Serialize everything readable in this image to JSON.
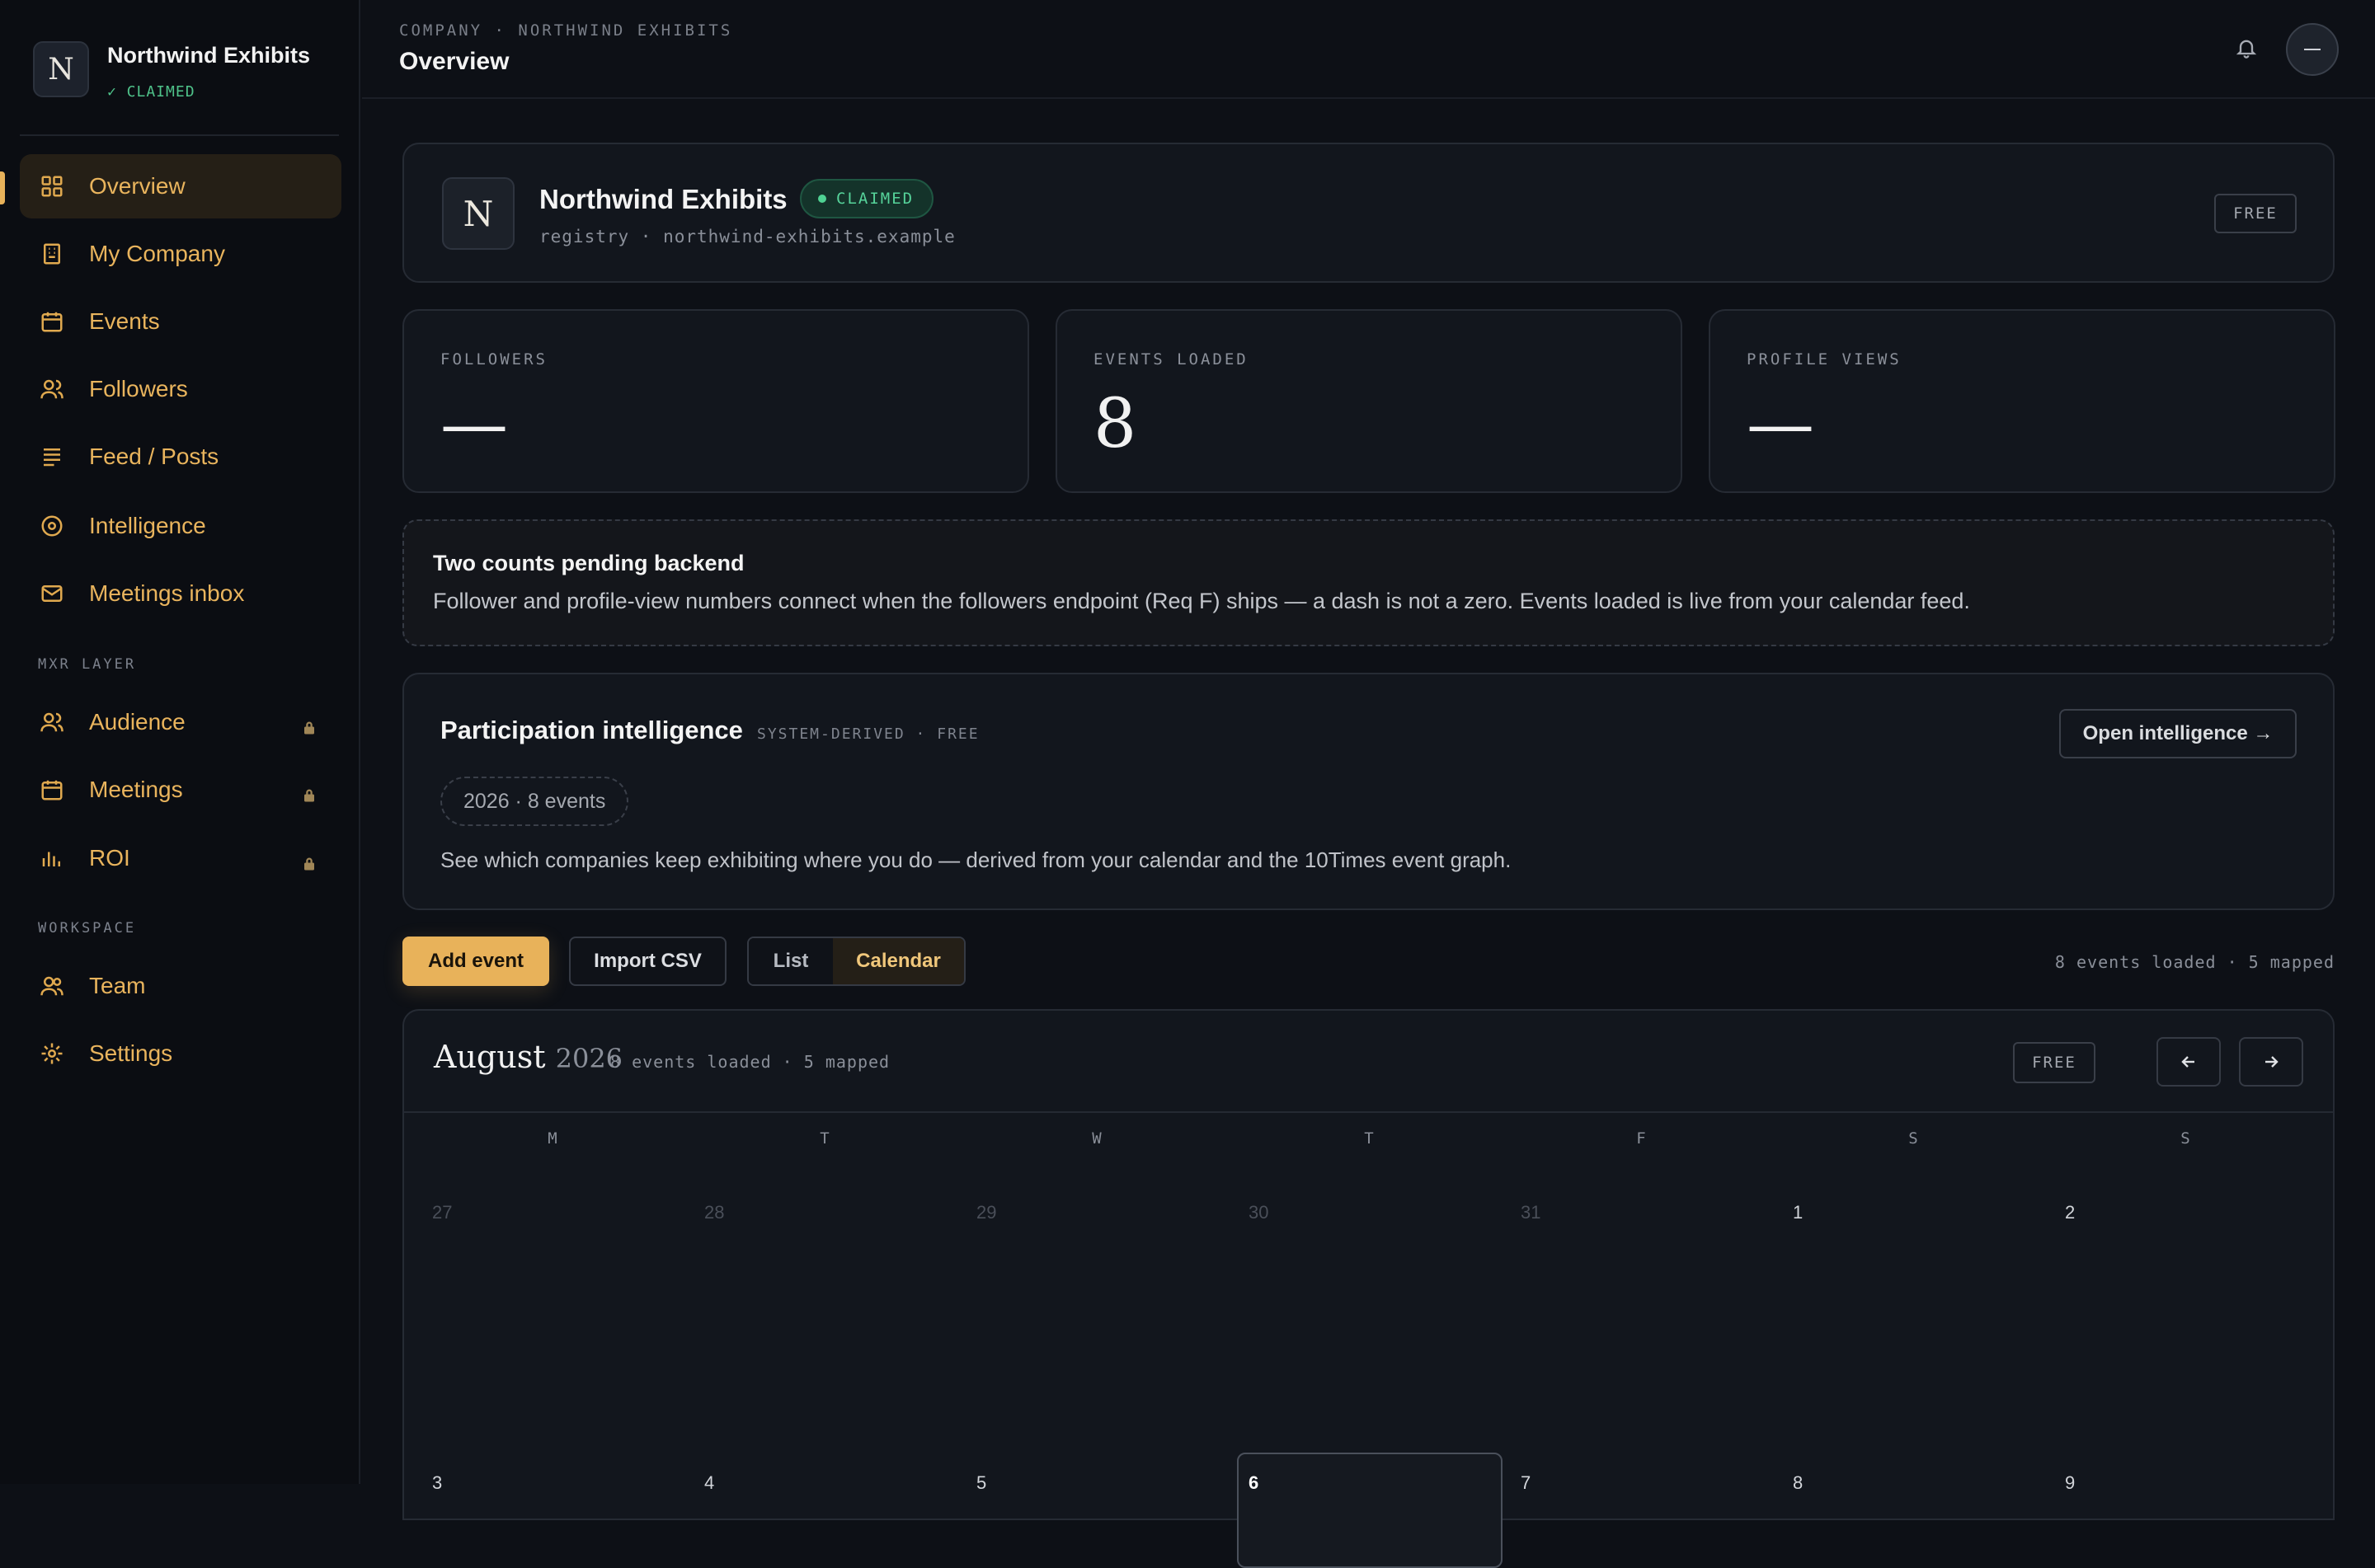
{
  "brand": {
    "logo_letter": "N",
    "name": "Northwind Exhibits",
    "status": "✓ CLAIMED"
  },
  "sidebar": {
    "items": [
      {
        "label": "Overview",
        "icon": "grid-icon",
        "active": true
      },
      {
        "label": "My Company",
        "icon": "building-icon"
      },
      {
        "label": "Events",
        "icon": "calendar-icon"
      },
      {
        "label": "Followers",
        "icon": "users-icon"
      },
      {
        "label": "Feed / Posts",
        "icon": "lines-icon"
      },
      {
        "label": "Intelligence",
        "icon": "target-icon"
      },
      {
        "label": "Meetings inbox",
        "icon": "mail-icon"
      }
    ],
    "section_mxr": "MXR LAYER",
    "mxr_items": [
      {
        "label": "Audience",
        "icon": "users-icon",
        "locked": true
      },
      {
        "label": "Meetings",
        "icon": "calendar-icon",
        "locked": true
      },
      {
        "label": "ROI",
        "icon": "bar-chart-icon",
        "locked": true
      }
    ],
    "section_workspace": "WORKSPACE",
    "workspace_items": [
      {
        "label": "Team",
        "icon": "users-icon"
      },
      {
        "label": "Settings",
        "icon": "gear-icon"
      }
    ]
  },
  "topbar": {
    "breadcrumb": "COMPANY · NORTHWIND EXHIBITS",
    "title": "Overview"
  },
  "company_card": {
    "logo_letter": "N",
    "name": "Northwind Exhibits",
    "badge": "CLAIMED",
    "subtitle": "registry · northwind-exhibits.example",
    "plan": "FREE"
  },
  "stats": [
    {
      "label": "FOLLOWERS",
      "value": "—"
    },
    {
      "label": "EVENTS LOADED",
      "value": "8"
    },
    {
      "label": "PROFILE VIEWS",
      "value": "—"
    }
  ],
  "notice": {
    "title": "Two counts pending backend",
    "body": "Follower and profile-view numbers connect when the followers endpoint (Req F) ships — a dash is not a zero. Events loaded is live from your calendar feed."
  },
  "intelligence": {
    "title": "Participation intelligence",
    "meta": "SYSTEM-DERIVED · FREE",
    "button": "Open intelligence →",
    "chip": "2026 · 8 events",
    "description": "See which companies keep exhibiting where you do — derived from your calendar and the 10Times event graph."
  },
  "toolbar": {
    "add_label": "Add event",
    "import_label": "Import CSV",
    "view_list": "List",
    "view_calendar": "Calendar",
    "active_view": "Calendar",
    "status": "8 events loaded · 5 mapped"
  },
  "calendar": {
    "month": "August",
    "year": "2026",
    "meta": "8 events loaded · 5 mapped",
    "plan": "FREE",
    "weekdays": [
      "M",
      "T",
      "W",
      "T",
      "F",
      "S",
      "S"
    ],
    "week1": [
      "27",
      "28",
      "29",
      "30",
      "31",
      "1",
      "2"
    ],
    "week2": [
      "3",
      "4",
      "5",
      "6",
      "7",
      "8",
      "9"
    ],
    "today": "6"
  },
  "colors": {
    "accent": "#e8b25a",
    "success": "#4fd293",
    "background": "#0d1016",
    "card": "#12161d"
  }
}
